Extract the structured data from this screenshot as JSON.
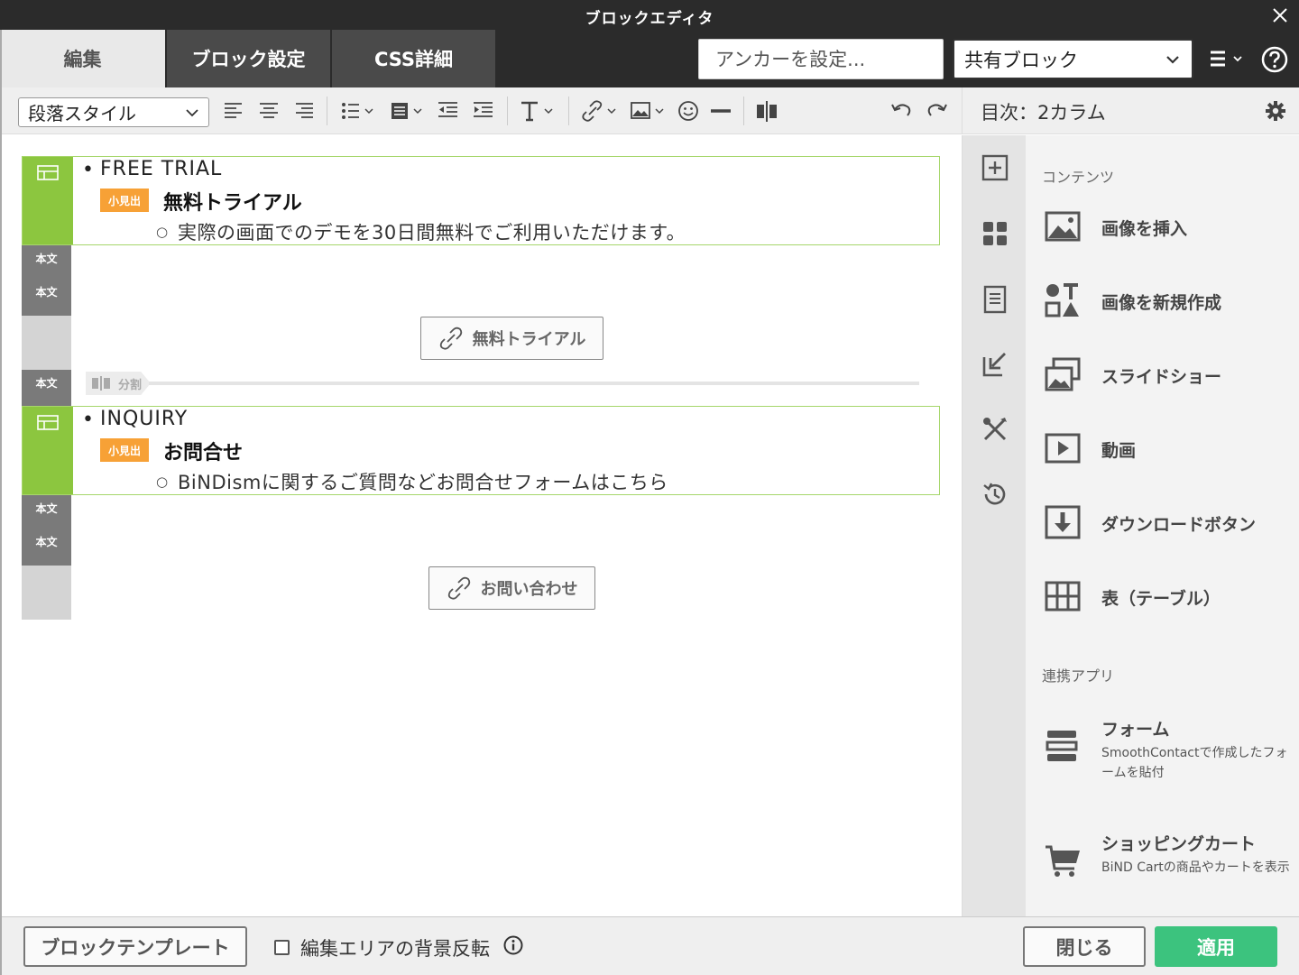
{
  "window": {
    "title": "ブロックエディタ"
  },
  "tabs": [
    {
      "label": "編集",
      "active": true
    },
    {
      "label": "ブロック設定",
      "active": false
    },
    {
      "label": "CSS詳細",
      "active": false
    }
  ],
  "anchor": {
    "placeholder": "アンカーを設定..."
  },
  "shared_block": {
    "value": "共有ブロック"
  },
  "toolbar": {
    "paragraph_style": "段落スタイル",
    "icons": [
      "align-left-icon",
      "align-center-icon",
      "align-right-icon",
      "bullet-list-icon",
      "box-icon",
      "outdent-icon",
      "indent-icon",
      "text-style-icon",
      "link-icon",
      "image-icon",
      "emoji-icon",
      "horizontal-rule-icon",
      "split-icon",
      "undo-icon",
      "redo-icon"
    ]
  },
  "sidebar": {
    "header": "目次：2カラム",
    "section_contents": "コンテンツ",
    "items": [
      {
        "label": "画像を挿入",
        "icon": "image-icon"
      },
      {
        "label": "画像を新規作成",
        "icon": "shapes-icon"
      },
      {
        "label": "スライドショー",
        "icon": "slideshow-icon"
      },
      {
        "label": "動画",
        "icon": "video-icon"
      },
      {
        "label": "ダウンロードボタン",
        "icon": "download-icon"
      },
      {
        "label": "表（テーブル）",
        "icon": "table-icon"
      }
    ],
    "section_apps": "連携アプリ",
    "apps": [
      {
        "label": "フォーム",
        "desc": "SmoothContactで作成したフォームを貼付",
        "icon": "form-icon"
      },
      {
        "label": "ショッピングカート",
        "desc": "BiND Cartの商品やカートを表示",
        "icon": "cart-icon"
      }
    ],
    "rail_icons": [
      "add-block-icon",
      "blocks-icon",
      "page-icon",
      "import-icon",
      "tools-icon",
      "history-icon"
    ]
  },
  "content": {
    "blocks": [
      {
        "title_en": "FREE TRIAL",
        "tag": "小見出",
        "heading": "無料トライアル",
        "desc": "実際の画面でのデモを30日間無料でご利用いただけます。"
      },
      {
        "title_en": "INQUIRY",
        "tag": "小見出",
        "heading": "お問合せ",
        "desc": "BiNDismに関するご質問などお問合せフォームはこちら"
      }
    ],
    "gutter_label": "本文",
    "buttons": [
      "無料トライアル",
      "お問い合わせ"
    ],
    "divider_label": "分割"
  },
  "footer": {
    "template_button": "ブロックテンプレート",
    "checkbox_label": "編集エリアの背景反転",
    "checkbox_checked": false,
    "close_button": "閉じる",
    "apply_button": "適用",
    "apply_color": "#3cc37e"
  },
  "colors": {
    "titlebar": "#2b2b2b",
    "block_accent": "#8cc63f",
    "tag": "#f7a136"
  }
}
